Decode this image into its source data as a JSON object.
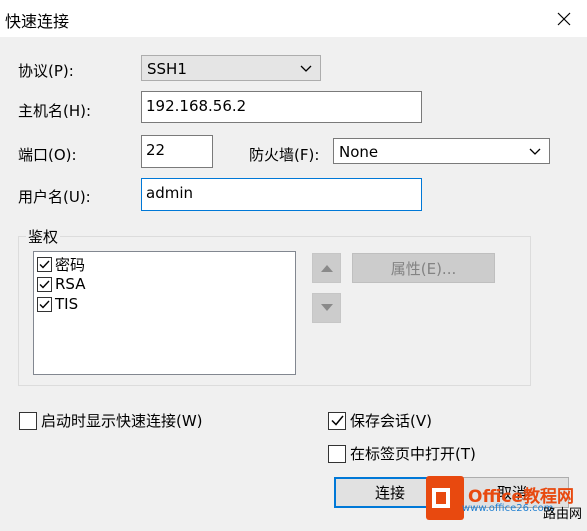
{
  "window": {
    "title": "快速连接",
    "close_icon": "close-icon"
  },
  "protocol": {
    "label": "协议(P):",
    "value": "SSH1"
  },
  "hostname": {
    "label": "主机名(H):",
    "value": "192.168.56.2"
  },
  "port": {
    "label": "端口(O):",
    "value": "22"
  },
  "firewall": {
    "label": "防火墙(F):",
    "value": "None"
  },
  "username": {
    "label": "用户名(U):",
    "value": "admin"
  },
  "auth": {
    "group_label": "鉴权",
    "items": [
      {
        "label": "密码",
        "checked": true
      },
      {
        "label": "RSA",
        "checked": true
      },
      {
        "label": "TIS",
        "checked": true
      }
    ],
    "properties_label": "属性(E)..."
  },
  "options": {
    "show_on_startup": {
      "label": "启动时显示快速连接(W)",
      "checked": false
    },
    "save_session": {
      "label": "保存会话(V)",
      "checked": true
    },
    "open_in_tab": {
      "label": "在标签页中打开(T)",
      "checked": false
    }
  },
  "buttons": {
    "connect_label": "连接",
    "cancel_label": "取消"
  },
  "watermark": {
    "brand": "Office教程网",
    "url": "www.office26.com",
    "sub": "路由网",
    "colors": {
      "orange": "#e8490f",
      "blue": "#1e7fd1"
    }
  }
}
